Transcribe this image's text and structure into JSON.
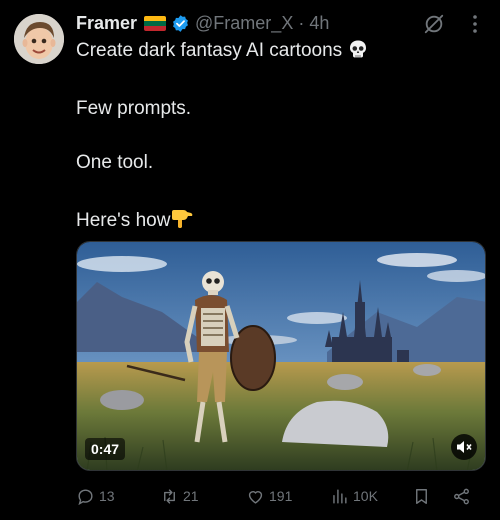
{
  "author": {
    "name": "Framer",
    "handle": "@Framer_X",
    "separator": "·",
    "time": "4h",
    "flag": [
      "#fdb913",
      "#006a44",
      "#c1272d"
    ],
    "verified_color": "#1d9bf0"
  },
  "icons": {
    "verified": "verified-badge-icon",
    "grok": "grok-icon",
    "more": "more-icon",
    "skull": "skull-emoji-icon",
    "hand": "pointing-down-hand-emoji-icon"
  },
  "text": {
    "line1": "Create dark fantasy AI cartoons",
    "line2": "Few prompts.",
    "line3": "One tool.",
    "line4": "Here's how"
  },
  "media": {
    "duration": "0:47"
  },
  "actions": {
    "replies": "13",
    "retweets": "21",
    "likes": "191",
    "views": "10K"
  },
  "colors": {
    "background": "#000000",
    "text": "#e7e9ea",
    "muted": "#71767b"
  }
}
